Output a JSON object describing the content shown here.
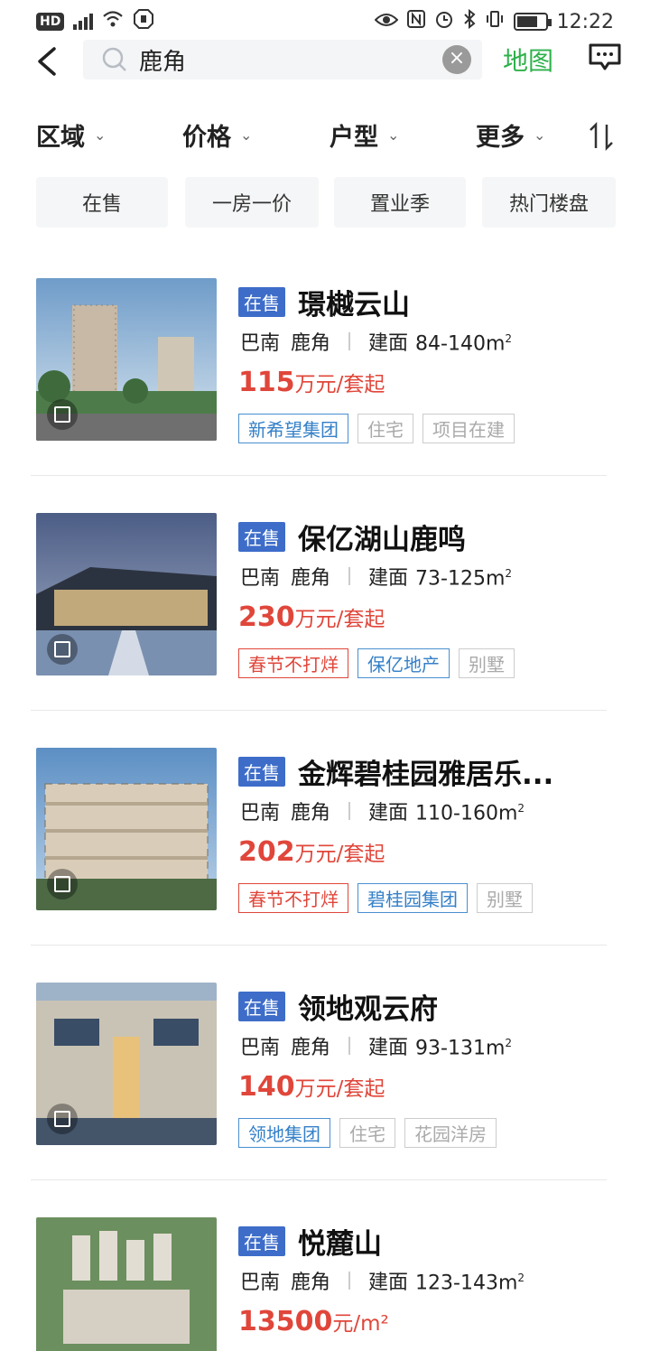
{
  "status_bar": {
    "time": "12:22",
    "net": "HD"
  },
  "search": {
    "value": "鹿角"
  },
  "header": {
    "map_label": "地图"
  },
  "filters": [
    {
      "label": "区域"
    },
    {
      "label": "价格"
    },
    {
      "label": "户型"
    },
    {
      "label": "更多"
    }
  ],
  "quick_chips": [
    {
      "label": "在售"
    },
    {
      "label": "一房一价"
    },
    {
      "label": "置业季"
    },
    {
      "label": "热门楼盘"
    }
  ],
  "listings": [
    {
      "status": "在售",
      "name": "璟樾云山",
      "district": "巴南",
      "area_name": "鹿角",
      "area_label": "建面",
      "area_range": "84-140m",
      "price": "115",
      "price_unit": "万元/套起",
      "tags": [
        {
          "text": "新希望集团",
          "style": "blue"
        },
        {
          "text": "住宅",
          "style": "gray"
        },
        {
          "text": "项目在建",
          "style": "gray"
        }
      ]
    },
    {
      "status": "在售",
      "name": "保亿湖山鹿鸣",
      "district": "巴南",
      "area_name": "鹿角",
      "area_label": "建面",
      "area_range": "73-125m",
      "price": "230",
      "price_unit": "万元/套起",
      "tags": [
        {
          "text": "春节不打烊",
          "style": "red"
        },
        {
          "text": "保亿地产",
          "style": "blue"
        },
        {
          "text": "别墅",
          "style": "gray"
        }
      ]
    },
    {
      "status": "在售",
      "name": "金辉碧桂园雅居乐...",
      "district": "巴南",
      "area_name": "鹿角",
      "area_label": "建面",
      "area_range": "110-160m",
      "price": "202",
      "price_unit": "万元/套起",
      "tags": [
        {
          "text": "春节不打烊",
          "style": "red"
        },
        {
          "text": "碧桂园集团",
          "style": "blue"
        },
        {
          "text": "别墅",
          "style": "gray"
        }
      ]
    },
    {
      "status": "在售",
      "name": "领地观云府",
      "district": "巴南",
      "area_name": "鹿角",
      "area_label": "建面",
      "area_range": "93-131m",
      "price": "140",
      "price_unit": "万元/套起",
      "tags": [
        {
          "text": "领地集团",
          "style": "blue"
        },
        {
          "text": "住宅",
          "style": "gray"
        },
        {
          "text": "花园洋房",
          "style": "gray"
        }
      ]
    },
    {
      "status": "在售",
      "name": "悦麓山",
      "district": "巴南",
      "area_name": "鹿角",
      "area_label": "建面",
      "area_range": "123-143m",
      "price": "13500",
      "price_unit": "元/m²",
      "tags": []
    }
  ],
  "colors": {
    "accent_blue": "#3e6dc9",
    "price_red": "#e0463a",
    "map_green": "#2eb14b"
  }
}
